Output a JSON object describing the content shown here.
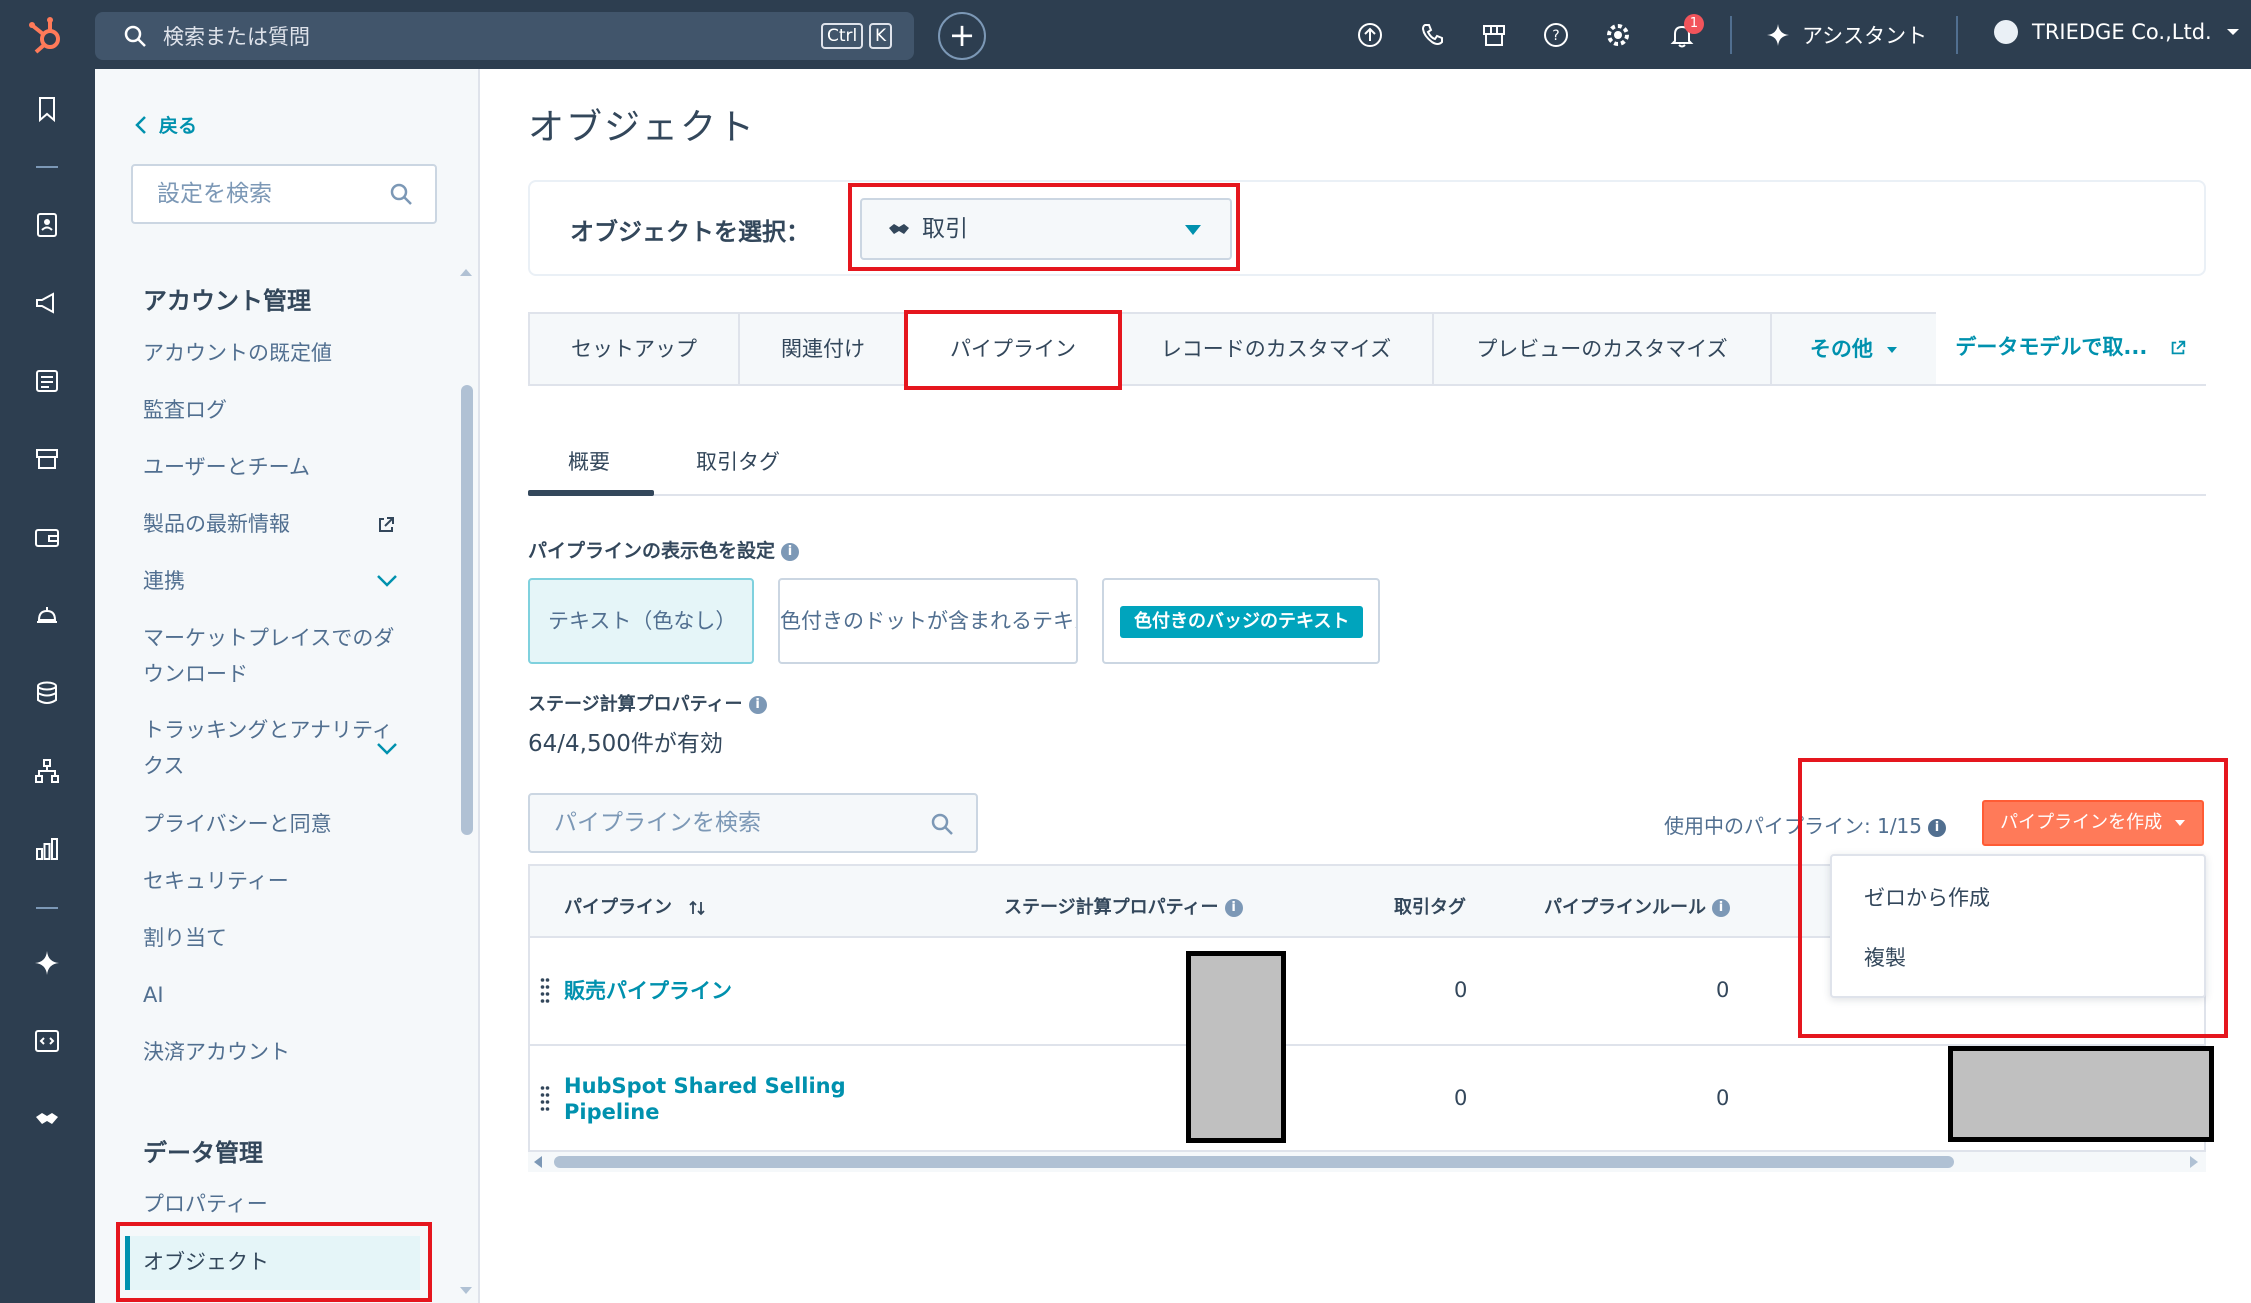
{
  "topbar": {
    "search_placeholder": "検索または質問",
    "kbd_ctrl": "Ctrl",
    "kbd_k": "K",
    "notification_count": "1",
    "assistant_label": "アシスタント",
    "account_name": "TRIEDGE Co.,Ltd."
  },
  "sidebar": {
    "back_label": "戻る",
    "search_placeholder": "設定を検索",
    "section_account": "アカウント管理",
    "items_account": [
      "アカウントの既定値",
      "監査ログ",
      "ユーザーとチーム",
      "製品の最新情報",
      "連携",
      "マーケットプレイスでのダウンロード",
      "トラッキングとアナリティクス",
      "プライバシーと同意",
      "セキュリティー",
      "割り当て",
      "AI",
      "決済アカウント"
    ],
    "section_data": "データ管理",
    "items_data": [
      "プロパティー",
      "オブジェクト"
    ]
  },
  "main": {
    "title": "オブジェクト",
    "object_select_label": "オブジェクトを選択：",
    "object_select_value": "取引",
    "tabs": [
      "セットアップ",
      "関連付け",
      "パイプライン",
      "レコードのカスタマイズ",
      "プレビューのカスタマイズ",
      "その他"
    ],
    "data_model_link": "データモデルで取...",
    "subtabs": [
      "概要",
      "取引タグ"
    ],
    "color_section_label": "パイプラインの表示色を設定",
    "color_options": [
      "テキスト（色なし）",
      "色付きのドットが含まれるテキスト",
      "色付きのバッジのテキスト"
    ],
    "stage_calc_label": "ステージ計算プロパティー",
    "stage_calc_value": "64/4,500件が有効",
    "pipeline_search_placeholder": "パイプラインを検索",
    "in_use_label": "使用中のパイプライン: 1/15",
    "create_button": "パイプラインを作成",
    "create_menu": [
      "ゼロから作成",
      "複製"
    ],
    "table": {
      "headers": [
        "パイプライン",
        "ステージ計算プロパティー",
        "取引タグ",
        "パイプラインルール"
      ],
      "rows": [
        {
          "name": "販売パイプライン",
          "deal_tags": "0",
          "rules": "0"
        },
        {
          "name": "HubSpot Shared Selling Pipeline",
          "deal_tags": "0",
          "rules": "0"
        }
      ]
    }
  },
  "colors": {
    "nav_bg": "#2d3e50",
    "accent": "#0091ae",
    "cta": "#ff7a59",
    "highlight": "#e5161e"
  }
}
